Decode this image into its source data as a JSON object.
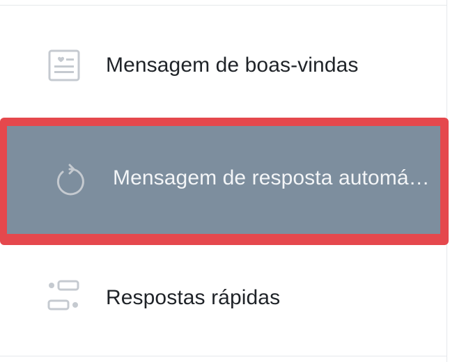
{
  "menu": {
    "items": [
      {
        "label": "Mensagem de boas-vindas",
        "icon": "welcome-message-icon",
        "selected": false
      },
      {
        "label": "Mensagem de resposta automá…",
        "icon": "auto-reply-icon",
        "selected": true
      },
      {
        "label": "Respostas rápidas",
        "icon": "quick-replies-icon",
        "selected": false
      }
    ]
  },
  "colors": {
    "highlight_border": "#e5484d",
    "selected_background": "#7d8e9e",
    "selected_text": "#f3f5f7",
    "text": "#1f2328",
    "icon": "#c5cad0"
  }
}
